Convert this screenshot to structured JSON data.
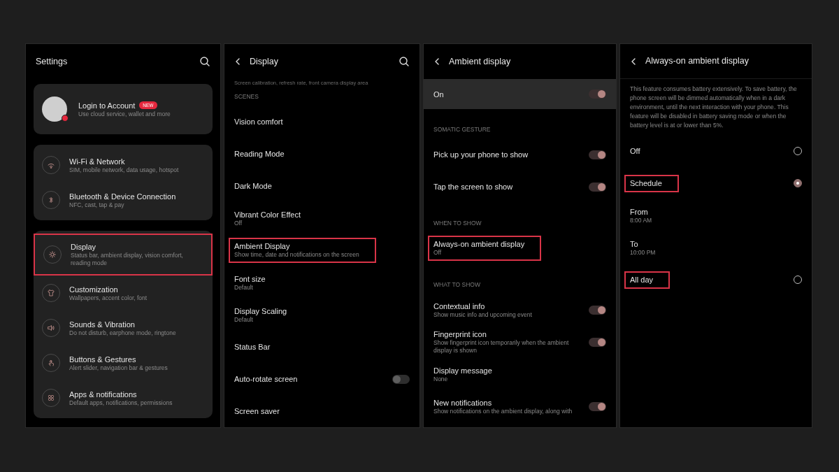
{
  "panels": [
    {
      "kind": "home",
      "title": "Settings",
      "back": false,
      "search": true,
      "account": {
        "title": "Login to Account",
        "badge": "NEW",
        "subtitle": "Use cloud service, wallet and more"
      },
      "groups": [
        {
          "items": [
            {
              "title": "Wi-Fi & Network",
              "subtitle": "SIM, mobile network, data usage, hotspot",
              "highlighted": false
            },
            {
              "title": "Bluetooth & Device Connection",
              "subtitle": "NFC, cast, tap & pay",
              "highlighted": false
            }
          ]
        },
        {
          "items": [
            {
              "title": "Display",
              "subtitle": "Status bar, ambient display, vision comfort, reading mode",
              "highlighted": true
            },
            {
              "title": "Customization",
              "subtitle": "Wallpapers, accent color, font",
              "highlighted": false
            },
            {
              "title": "Sounds & Vibration",
              "subtitle": "Do not disturb, earphone mode, ringtone",
              "highlighted": false
            },
            {
              "title": "Buttons & Gestures",
              "subtitle": "Alert slider, navigation bar & gestures",
              "highlighted": false
            },
            {
              "title": "Apps & notifications",
              "subtitle": "Default apps, notifications, permissions",
              "highlighted": false
            }
          ]
        }
      ]
    },
    {
      "kind": "list",
      "title": "Display",
      "back": true,
      "search": true,
      "items": [
        {
          "kind": "note",
          "text": "Screen calibration, refresh rate, front camera display area"
        },
        {
          "kind": "header",
          "text": "SCENES"
        },
        {
          "kind": "entry",
          "title": "Vision comfort",
          "highlighted": false
        },
        {
          "kind": "entry",
          "title": "Reading Mode",
          "highlighted": false
        },
        {
          "kind": "entry",
          "title": "Dark Mode",
          "highlighted": false
        },
        {
          "kind": "entry",
          "title": "Vibrant Color Effect",
          "subtitle": "Off",
          "highlighted": false
        },
        {
          "kind": "entry",
          "title": "Ambient Display",
          "subtitle": "Show time, date and notifications on the screen",
          "highlighted": true
        },
        {
          "kind": "entry",
          "title": "Font size",
          "subtitle": "Default",
          "highlighted": false
        },
        {
          "kind": "entry",
          "title": "Display Scaling",
          "subtitle": "Default",
          "highlighted": false
        },
        {
          "kind": "entry",
          "title": "Status Bar",
          "highlighted": false
        },
        {
          "kind": "toggle",
          "title": "Auto-rotate screen",
          "on": false,
          "highlighted": false
        },
        {
          "kind": "entry",
          "title": "Screen saver",
          "highlighted": false
        }
      ]
    },
    {
      "kind": "list",
      "title": "Ambient display",
      "back": true,
      "search": false,
      "items": [
        {
          "kind": "banner",
          "title": "On",
          "on": true
        },
        {
          "kind": "header",
          "text": "SOMATIC GESTURE"
        },
        {
          "kind": "toggle",
          "title": "Pick up your phone to show",
          "on": true,
          "highlighted": false
        },
        {
          "kind": "toggle",
          "title": "Tap the screen to show",
          "on": true,
          "highlighted": false
        },
        {
          "kind": "header",
          "text": "WHEN TO SHOW"
        },
        {
          "kind": "entry",
          "title": "Always-on ambient display",
          "subtitle": "Off",
          "highlighted": true
        },
        {
          "kind": "header",
          "text": "WHAT TO SHOW"
        },
        {
          "kind": "toggle",
          "title": "Contextual info",
          "subtitle": "Show music info and upcoming event",
          "on": true,
          "highlighted": false
        },
        {
          "kind": "toggle",
          "title": "Fingerprint icon",
          "subtitle": "Show fingerprint icon temporarily when the ambient display is shown",
          "on": true,
          "highlighted": false
        },
        {
          "kind": "entry",
          "title": "Display message",
          "subtitle": "None",
          "highlighted": false
        },
        {
          "kind": "toggle",
          "title": "New notifications",
          "subtitle": "Show notifications on the ambient display, along with",
          "on": true,
          "highlighted": false
        }
      ]
    },
    {
      "kind": "list",
      "title": "Always-on ambient display",
      "back": true,
      "search": false,
      "items": [
        {
          "kind": "paragraph",
          "text": "This feature consumes battery extensively. To save battery, the phone screen will be dimmed automatically when in a dark environment, until the next interaction with your phone. This feature will be disabled in battery saving mode or when the battery level is at or lower than 5%."
        },
        {
          "kind": "radio",
          "title": "Off",
          "selected": false,
          "highlighted": false
        },
        {
          "kind": "radio",
          "title": "Schedule",
          "selected": true,
          "highlighted": true
        },
        {
          "kind": "entry",
          "title": "From",
          "subtitle": "8:00 AM",
          "highlighted": false
        },
        {
          "kind": "entry",
          "title": "To",
          "subtitle": "10:00 PM",
          "highlighted": false
        },
        {
          "kind": "radio",
          "title": "All day",
          "selected": false,
          "highlighted": true
        }
      ]
    }
  ]
}
